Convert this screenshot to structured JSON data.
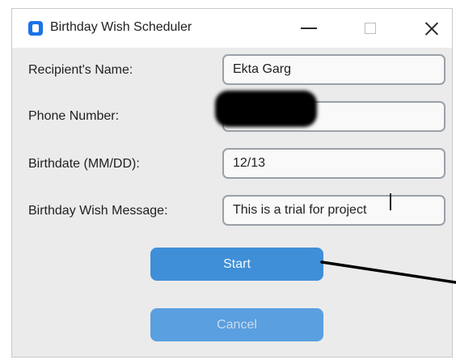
{
  "window": {
    "title": "Birthday Wish Scheduler",
    "icon": "app-icon"
  },
  "form": {
    "recipient_label": "Recipient's Name:",
    "recipient_value": "Ekta Garg",
    "phone_label": "Phone Number:",
    "phone_value": "",
    "birthdate_label": "Birthdate (MM/DD):",
    "birthdate_value": "12/13",
    "message_label": "Birthday Wish Message:",
    "message_value": "This is a trial for project"
  },
  "buttons": {
    "start_label": "Start",
    "cancel_label": "Cancel"
  },
  "colors": {
    "accent": "#3f8fd8",
    "window_bg": "#ebebeb"
  }
}
